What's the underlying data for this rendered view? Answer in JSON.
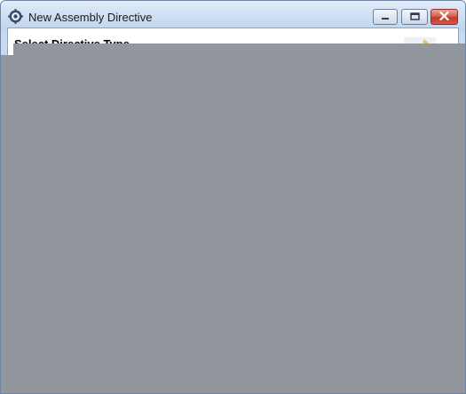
{
  "window": {
    "title": "New Assembly Directive",
    "minimize_icon": "minimize-icon",
    "maximize_icon": "maximize-icon",
    "close_icon": "close-icon",
    "app_icon": "gear-icon"
  },
  "wizard": {
    "header_title": "Select Directive Type",
    "graphic_icon": "wizard-banner-icon"
  },
  "colors": {
    "overlay": "#91979d",
    "close_button": "#c43a2a",
    "titlebar": "#cfdff2"
  }
}
